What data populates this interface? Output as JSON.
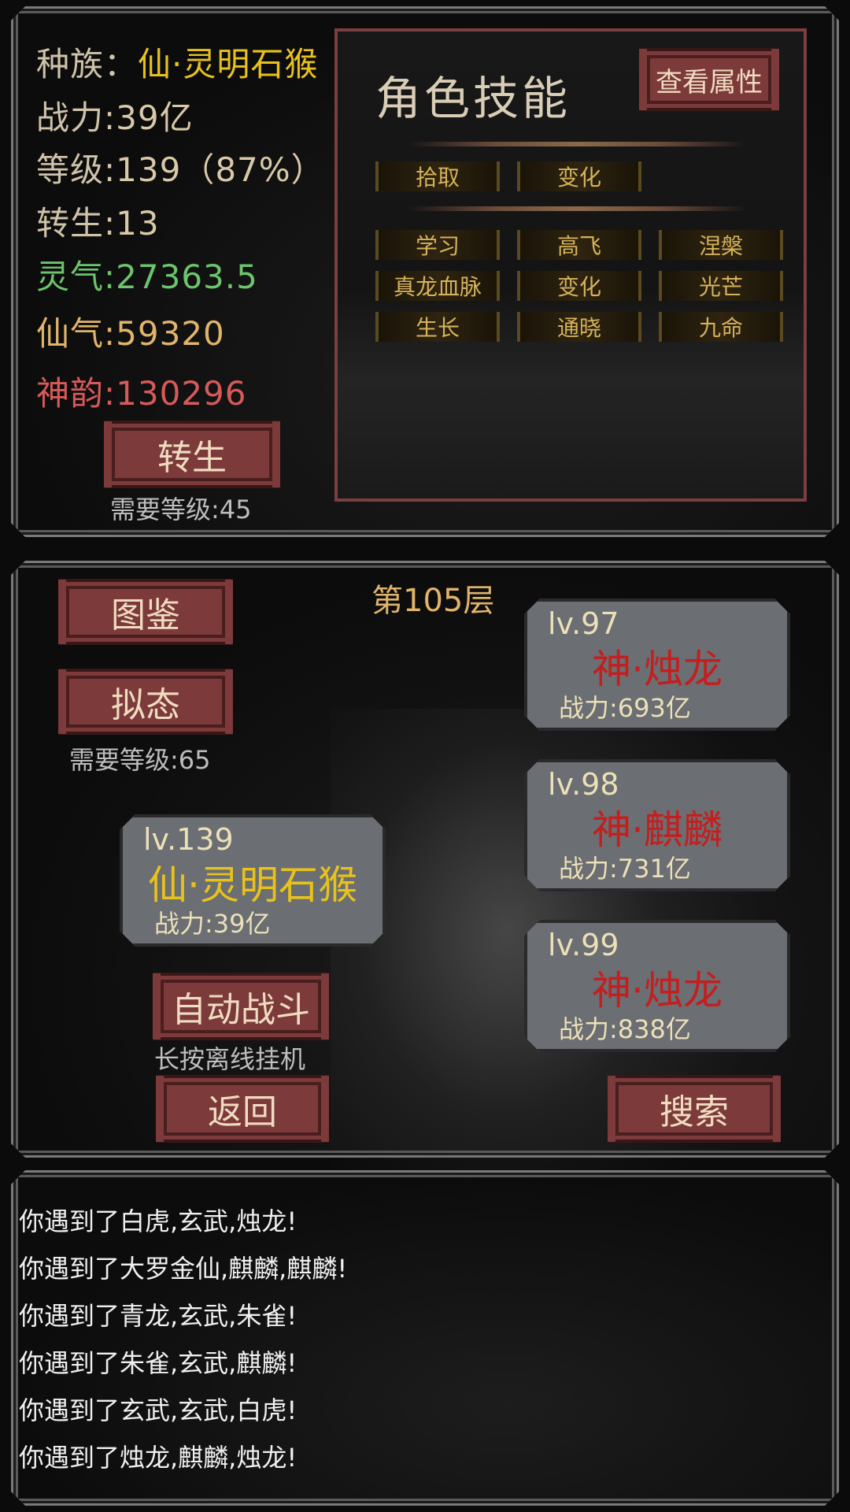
{
  "stats": {
    "race_label": "种族：",
    "race_value": "仙·灵明石猴",
    "power_label": "战力",
    "power_value": ":39亿",
    "level_label": "等级",
    "level_value": ":139（87%）",
    "rebirth_label": "转生",
    "rebirth_value": ":13",
    "lingqi_label": "灵气",
    "lingqi_value": ":27363.5",
    "xianqi_label": "仙气",
    "xianqi_value": ":59320",
    "shenyun_label": "神韵",
    "shenyun_value": ":130296"
  },
  "rebirth_button": "转生",
  "rebirth_hint": "需要等级:45",
  "skills": {
    "title": "角色技能",
    "view_attrs_button": "查看属性",
    "row1": [
      "拾取",
      "变化"
    ],
    "grid": [
      "学习",
      "高飞",
      "涅槃",
      "真龙血脉",
      "变化",
      "光芒",
      "生长",
      "通晓",
      "九命"
    ]
  },
  "battle": {
    "floor": "第105层",
    "codex_button": "图鉴",
    "mimic_button": "拟态",
    "mimic_hint": "需要等级:65",
    "player": {
      "level": "lv.139",
      "name": "仙·灵明石猴",
      "power": "战力:39亿"
    },
    "enemies": [
      {
        "level": "lv.97",
        "name": "神·烛龙",
        "power": "战力:693亿"
      },
      {
        "level": "lv.98",
        "name": "神·麒麟",
        "power": "战力:731亿"
      },
      {
        "level": "lv.99",
        "name": "神·烛龙",
        "power": "战力:838亿"
      }
    ],
    "auto_battle_button": "自动战斗",
    "auto_battle_hint": "长按离线挂机",
    "back_button": "返回",
    "search_button": "搜索"
  },
  "log": [
    "你遇到了白虎,玄武,烛龙!",
    "你遇到了大罗金仙,麒麟,麒麟!",
    "你遇到了青龙,玄武,朱雀!",
    "你遇到了朱雀,玄武,麒麟!",
    "你遇到了玄武,玄武,白虎!",
    "你遇到了烛龙,麒麟,烛龙!"
  ],
  "colors": {
    "yellow": "#e8c21c",
    "green": "#6cc46c",
    "gold": "#e0b46a",
    "red": "#d65a5a",
    "enemy_red": "#c41e1e"
  }
}
